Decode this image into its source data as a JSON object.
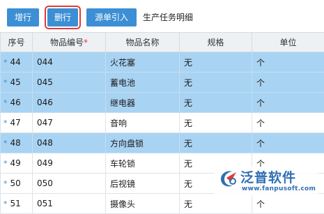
{
  "toolbar": {
    "add_label": "增行",
    "delete_label": "删行",
    "source_import_label": "源单引入",
    "section_title": "生产任务明细"
  },
  "table": {
    "headers": {
      "seq": "序号",
      "code": "物品编号",
      "code_required": "*",
      "name": "物品名称",
      "spec": "规格",
      "unit": "单位"
    },
    "rows": [
      {
        "marker": "*",
        "seq": "44",
        "code": "044",
        "name": "火花塞",
        "spec": "无",
        "unit": "个"
      },
      {
        "marker": "*",
        "seq": "45",
        "code": "045",
        "name": "蓄电池",
        "spec": "无",
        "unit": "个"
      },
      {
        "marker": "*",
        "seq": "46",
        "code": "046",
        "name": "继电器",
        "spec": "无",
        "unit": "个"
      },
      {
        "marker": "*",
        "seq": "47",
        "code": "047",
        "name": "音响",
        "spec": "无",
        "unit": "个"
      },
      {
        "marker": "*",
        "seq": "48",
        "code": "048",
        "name": "方向盘锁",
        "spec": "无",
        "unit": "个"
      },
      {
        "marker": "*",
        "seq": "49",
        "code": "049",
        "name": "车轮锁",
        "spec": "无",
        "unit": "个"
      },
      {
        "marker": "*",
        "seq": "50",
        "code": "050",
        "name": "后视镜",
        "spec": "无",
        "unit": "个"
      },
      {
        "marker": "*",
        "seq": "51",
        "code": "051",
        "name": "摄像头",
        "spec": "无",
        "unit": "个"
      }
    ]
  },
  "watermark": {
    "brand": "泛普软件",
    "url": "www.fanpusoft.com"
  },
  "colors": {
    "button_blue": "#3c8fd4",
    "selected_row": "#a9d3f2",
    "highlight_border": "#e53935"
  }
}
